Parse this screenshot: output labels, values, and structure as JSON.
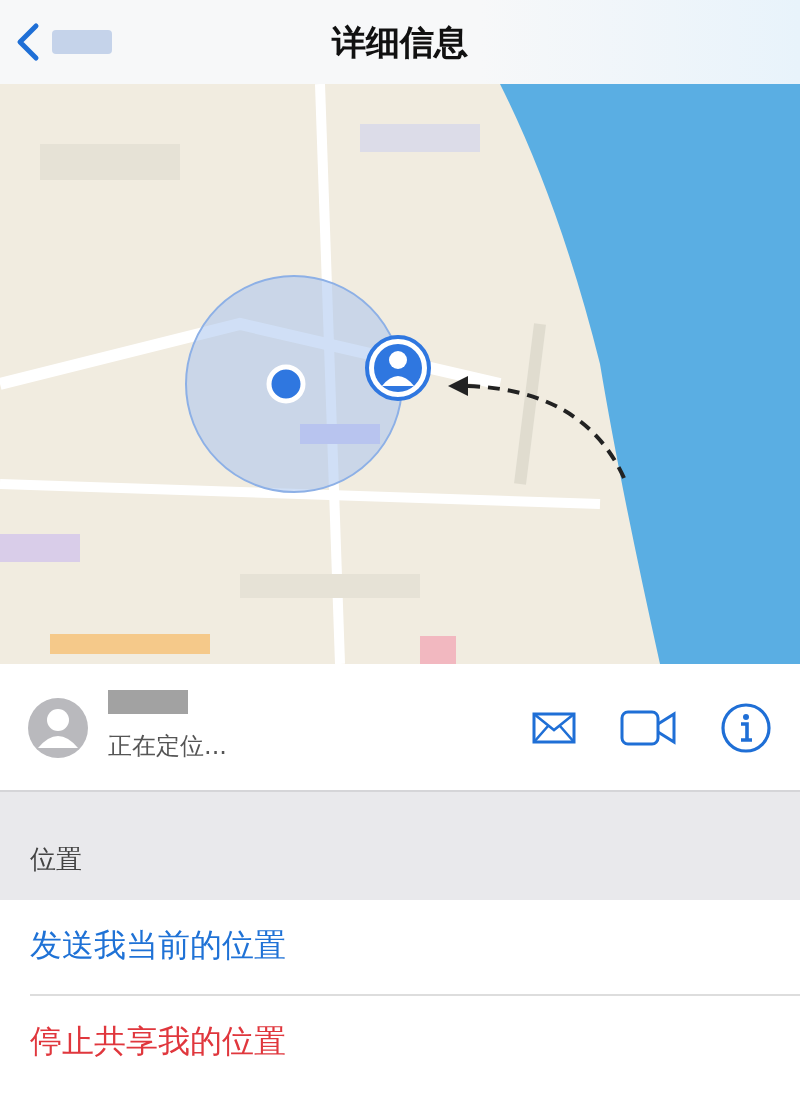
{
  "nav": {
    "title": "详细信息"
  },
  "contact": {
    "status": "正在定位..."
  },
  "section_header": "位置",
  "actions": [
    {
      "label": "发送我当前的位置",
      "destructive": false
    },
    {
      "label": "停止共享我的位置",
      "destructive": true
    }
  ]
}
